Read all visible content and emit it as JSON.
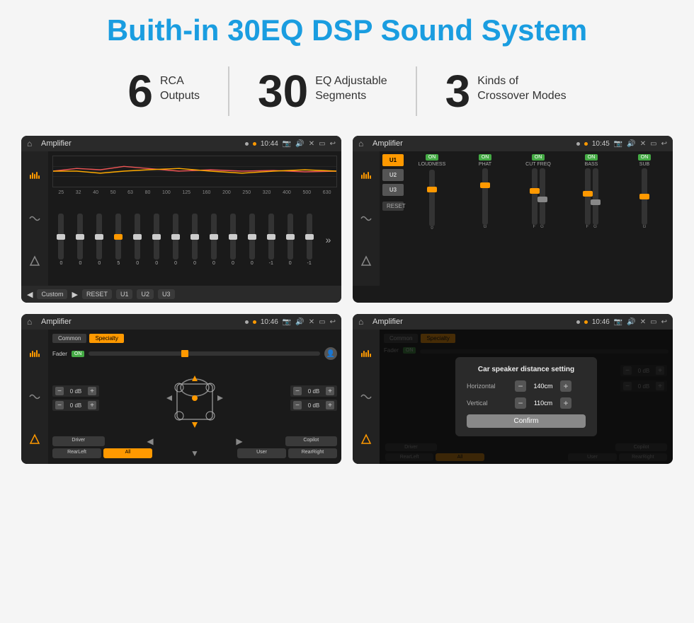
{
  "page": {
    "title": "Buith-in 30EQ DSP Sound System",
    "title_color": "#1a9de0"
  },
  "features": [
    {
      "number": "6",
      "line1": "RCA",
      "line2": "Outputs"
    },
    {
      "number": "30",
      "line1": "EQ Adjustable",
      "line2": "Segments"
    },
    {
      "number": "3",
      "line1": "Kinds of",
      "line2": "Crossover Modes"
    }
  ],
  "screens": [
    {
      "id": "screen1",
      "status_title": "Amplifier",
      "status_time": "10:44",
      "type": "eq",
      "freq_labels": [
        "25",
        "32",
        "40",
        "50",
        "63",
        "80",
        "100",
        "125",
        "160",
        "200",
        "250",
        "320",
        "400",
        "500",
        "630"
      ],
      "slider_values": [
        "0",
        "0",
        "0",
        "5",
        "0",
        "0",
        "0",
        "0",
        "0",
        "0",
        "0",
        "-1",
        "0",
        "-1"
      ],
      "preset": "Custom",
      "buttons": [
        "RESET",
        "U1",
        "U2",
        "U3"
      ]
    },
    {
      "id": "screen2",
      "status_title": "Amplifier",
      "status_time": "10:45",
      "type": "crossover",
      "presets": [
        "U1",
        "U2",
        "U3"
      ],
      "modules": [
        {
          "toggle": "ON",
          "label": "LOUDNESS"
        },
        {
          "toggle": "ON",
          "label": "PHAT"
        },
        {
          "toggle": "ON",
          "label": "CUT FREQ"
        },
        {
          "toggle": "ON",
          "label": "BASS"
        },
        {
          "toggle": "ON",
          "label": "SUB"
        }
      ],
      "reset_label": "RESET"
    },
    {
      "id": "screen3",
      "status_title": "Amplifier",
      "status_time": "10:46",
      "type": "speaker",
      "tabs": [
        "Common",
        "Specialty"
      ],
      "fader_label": "Fader",
      "fader_toggle": "ON",
      "db_values": [
        "0 dB",
        "0 dB",
        "0 dB",
        "0 dB"
      ],
      "bottom_buttons": [
        "Driver",
        "",
        "",
        "Copilot",
        "RearLeft",
        "All",
        "User",
        "RearRight"
      ]
    },
    {
      "id": "screen4",
      "status_title": "Amplifier",
      "status_time": "10:46",
      "type": "dialog",
      "tabs": [
        "Common",
        "Specialty"
      ],
      "dialog_title": "Car speaker distance setting",
      "horizontal_label": "Horizontal",
      "horizontal_value": "140cm",
      "vertical_label": "Vertical",
      "vertical_value": "110cm",
      "confirm_label": "Confirm",
      "db_values": [
        "0 dB",
        "0 dB"
      ],
      "bottom_buttons": [
        "Driver",
        "",
        "",
        "Copilot",
        "RearLeft",
        "All",
        "User",
        "RearRight"
      ]
    }
  ]
}
